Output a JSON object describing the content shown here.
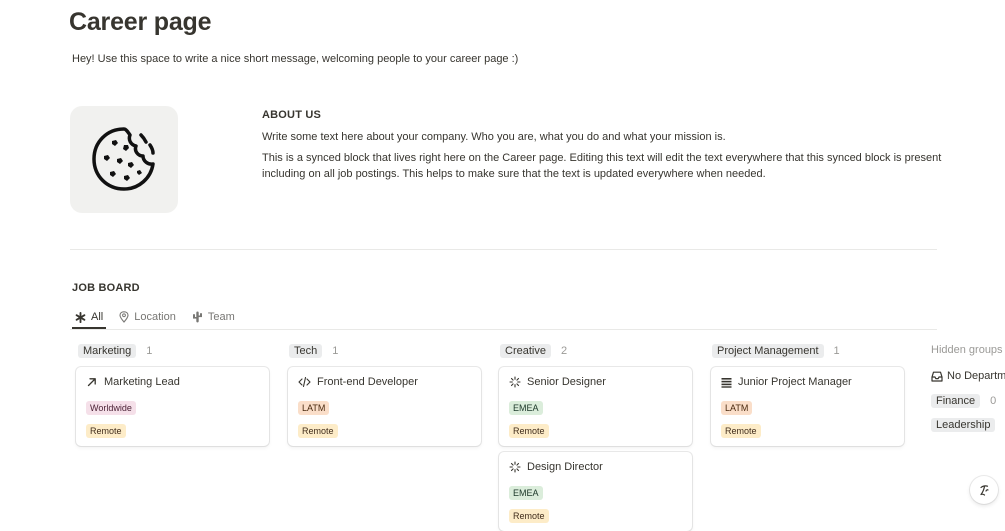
{
  "page": {
    "title": "Career page",
    "welcome": "Hey! Use this space to write a nice short message, welcoming people to your career page :)"
  },
  "about": {
    "heading": "ABOUT US",
    "p1": "Write some text here about your company. Who you are, what you do and what your mission is.",
    "p2": "This is a synced block that lives right here on the Career page. Editing this text will edit the text everywhere that this synced block is present including on all job postings. This helps to make sure that the text is updated everywhere when needed."
  },
  "job_board": {
    "heading": "JOB BOARD",
    "tabs": [
      {
        "label": "All",
        "icon": "asterisk-icon",
        "active": true
      },
      {
        "label": "Location",
        "icon": "map-pin-icon",
        "active": false
      },
      {
        "label": "Team",
        "icon": "cactus-icon",
        "active": false
      }
    ],
    "groups": [
      {
        "name": "Marketing",
        "count": "1"
      },
      {
        "name": "Tech",
        "count": "1"
      },
      {
        "name": "Creative",
        "count": "2"
      },
      {
        "name": "Project Management",
        "count": "1"
      }
    ],
    "cards": [
      {
        "title": "Marketing Lead",
        "icon": "arrow-up-right-icon",
        "location": "Worldwide",
        "type": "Remote"
      },
      {
        "title": "Front-end Developer",
        "icon": "code-icon",
        "location": "LATM",
        "type": "Remote"
      },
      {
        "title": "Senior Designer",
        "icon": "loading-icon",
        "location": "EMEA",
        "type": "Remote"
      },
      {
        "title": "Design Director",
        "icon": "loading-icon",
        "location": "EMEA",
        "type": "Remote"
      },
      {
        "title": "Junior Project Manager",
        "icon": "list-icon",
        "location": "LATM",
        "type": "Remote"
      }
    ],
    "hidden_groups": {
      "label": "Hidden groups",
      "items": [
        {
          "name": "No Departm",
          "count": ""
        },
        {
          "name": "Finance",
          "count": "0"
        },
        {
          "name": "Leadership",
          "count": ""
        }
      ]
    }
  },
  "colors": {
    "text": "#37352f",
    "muted": "#787774",
    "tag_worldwide": "#f5e0e9",
    "tag_latm": "#fadec9",
    "tag_emea": "#dbeddb",
    "tag_remote": "#fdecc8"
  }
}
